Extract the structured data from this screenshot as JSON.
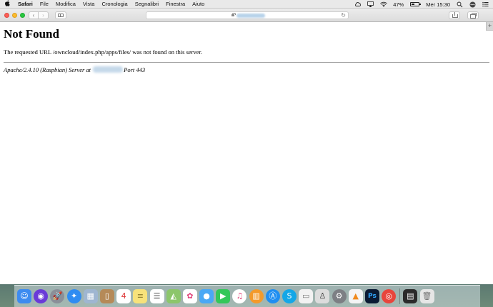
{
  "menubar": {
    "apple_icon": "apple-icon",
    "app_name": "Safari",
    "items": [
      "File",
      "Modifica",
      "Vista",
      "Cronologia",
      "Segnalibri",
      "Finestra",
      "Aiuto"
    ],
    "battery_percent": "47%",
    "battery_level": 0.47,
    "clock": "Mer 15:30",
    "status_icons": [
      "adobe-cc-icon",
      "airplay-icon",
      "wifi-icon",
      "battery-icon",
      "spotlight-icon",
      "siri-icon",
      "notification-center-icon"
    ]
  },
  "toolbar": {
    "back_glyph": "‹",
    "forward_glyph": "›",
    "reload_glyph": "↻",
    "new_tab_glyph": "+"
  },
  "page": {
    "heading": "Not Found",
    "message": "The requested URL /owncloud/index.php/apps/files/ was not found on this server.",
    "server_prefix": "Apache/2.4.10 (Raspbian) Server at",
    "server_suffix": "Port 443"
  },
  "dock": {
    "apps": [
      {
        "name": "finder-icon",
        "color": "#3d8bf0",
        "glyph": "☺"
      },
      {
        "name": "siri-icon",
        "color": "#6a3ad8",
        "glyph": "◉"
      },
      {
        "name": "launchpad-icon",
        "color": "#8a8f98",
        "glyph": "🚀"
      },
      {
        "name": "safari-icon",
        "color": "#2f8cf2",
        "glyph": "✦"
      },
      {
        "name": "preview-icon",
        "color": "#9fb6d1",
        "glyph": "▦"
      },
      {
        "name": "contacts-icon",
        "color": "#b58a58",
        "glyph": "▯"
      },
      {
        "name": "calendar-icon",
        "color": "#ffffff",
        "glyph": "4"
      },
      {
        "name": "notes-icon",
        "color": "#f7e27a",
        "glyph": "≡"
      },
      {
        "name": "reminders-icon",
        "color": "#ffffff",
        "glyph": "☰"
      },
      {
        "name": "maps-icon",
        "color": "#8cc66b",
        "glyph": "◭"
      },
      {
        "name": "photos-icon",
        "color": "#ffffff",
        "glyph": "✿"
      },
      {
        "name": "messages-icon",
        "color": "#4aa8f5",
        "glyph": "●"
      },
      {
        "name": "facetime-icon",
        "color": "#34c759",
        "glyph": "▶"
      },
      {
        "name": "itunes-icon",
        "color": "#ffffff",
        "glyph": "♫"
      },
      {
        "name": "ibooks-icon",
        "color": "#f39a2b",
        "glyph": "▥"
      },
      {
        "name": "app-store-icon",
        "color": "#1f8ef1",
        "glyph": "Ⓐ"
      },
      {
        "name": "skype-icon",
        "color": "#14a7e7",
        "glyph": "S"
      },
      {
        "name": "textedit-icon",
        "color": "#f2f2f2",
        "glyph": "▭"
      },
      {
        "name": "automator-icon",
        "color": "#dcdcdc",
        "glyph": "♙"
      },
      {
        "name": "system-preferences-icon",
        "color": "#7d7f84",
        "glyph": "⚙"
      },
      {
        "name": "vlc-icon",
        "color": "#f4f4f4",
        "glyph": "▲"
      },
      {
        "name": "photoshop-icon",
        "color": "#0b1a33",
        "glyph": "Ps"
      },
      {
        "name": "chrome-icon",
        "color": "#e8453c",
        "glyph": "◎"
      }
    ],
    "trailing": [
      {
        "name": "terminal-folder-icon",
        "color": "#2b2b2b",
        "glyph": "▤"
      },
      {
        "name": "trash-icon",
        "color": "#e6e6e6",
        "glyph": "🗑"
      }
    ]
  }
}
